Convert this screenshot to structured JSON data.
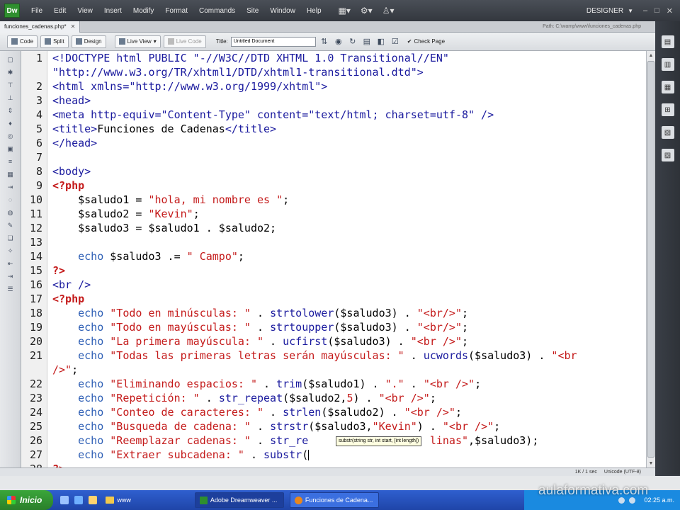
{
  "menubar": {
    "logo": "Dw",
    "items": [
      "File",
      "Edit",
      "View",
      "Insert",
      "Modify",
      "Format",
      "Commands",
      "Site",
      "Window",
      "Help"
    ],
    "workspace": "DESIGNER"
  },
  "tabs": {
    "doc_tab": "funciones_cadenas.php*",
    "path": "Path: C:\\wamp\\www\\funciones_cadenas.php"
  },
  "toolbar": {
    "code": "Code",
    "split": "Split",
    "design": "Design",
    "live_view": "Live View",
    "live_code": "Live Code",
    "title_label": "Title:",
    "title_value": "Untitled Document",
    "check_page": "Check Page"
  },
  "tooltip": "substr(string str, int start, [int length])",
  "status": {
    "size": "1K / 1 sec",
    "encoding": "Unicode (UTF-8)"
  },
  "taskbar": {
    "start": "Inicio",
    "folder": "www",
    "task1": "Adobe Dreamweaver ...",
    "task2": "Funciones de Cadena...",
    "clock": "02:25 a.m."
  },
  "watermark": "aulaformativa.com",
  "editor": {
    "lines": [
      {
        "n": "1",
        "tokens": [
          [
            "tag",
            "<!DOCTYPE html PUBLIC \"-//W3C//DTD XHTML 1.0 Transitional//EN\""
          ]
        ]
      },
      {
        "n": "",
        "tokens": [
          [
            "tag",
            "\"http://www.w3.org/TR/xhtml1/DTD/xhtml1-transitional.dtd\">"
          ]
        ]
      },
      {
        "n": "2",
        "tokens": [
          [
            "tag",
            "<html xmlns=\"http://www.w3.org/1999/xhtml\">"
          ]
        ]
      },
      {
        "n": "3",
        "tokens": [
          [
            "tag",
            "<head>"
          ]
        ]
      },
      {
        "n": "4",
        "tokens": [
          [
            "tag",
            "<meta http-equiv=\"Content-Type\" content=\"text/html; charset=utf-8\" />"
          ]
        ]
      },
      {
        "n": "5",
        "tokens": [
          [
            "tag",
            "<title>"
          ],
          [
            "pl",
            "Funciones de Cadenas"
          ],
          [
            "tag",
            "</title>"
          ]
        ]
      },
      {
        "n": "6",
        "tokens": [
          [
            "tag",
            "</head>"
          ]
        ]
      },
      {
        "n": "7",
        "tokens": []
      },
      {
        "n": "8",
        "tokens": [
          [
            "tag",
            "<body>"
          ]
        ]
      },
      {
        "n": "9",
        "tokens": [
          [
            "php",
            "<?php"
          ]
        ]
      },
      {
        "n": "10",
        "tokens": [
          [
            "var",
            "    $saludo1 = "
          ],
          [
            "str",
            "\"hola, mi nombre es \""
          ],
          [
            "pl",
            ";"
          ]
        ]
      },
      {
        "n": "11",
        "tokens": [
          [
            "var",
            "    $saludo2 = "
          ],
          [
            "str",
            "\"Kevin\""
          ],
          [
            "pl",
            ";"
          ]
        ]
      },
      {
        "n": "12",
        "tokens": [
          [
            "var",
            "    $saludo3 = $saludo1 . $saludo2;"
          ]
        ]
      },
      {
        "n": "13",
        "tokens": []
      },
      {
        "n": "14",
        "tokens": [
          [
            "kw",
            "    echo"
          ],
          [
            "var",
            " $saludo3 .= "
          ],
          [
            "str",
            "\" Campo\""
          ],
          [
            "pl",
            ";"
          ]
        ]
      },
      {
        "n": "15",
        "tokens": [
          [
            "php",
            "?>"
          ]
        ]
      },
      {
        "n": "16",
        "tokens": [
          [
            "tag",
            "<br />"
          ]
        ]
      },
      {
        "n": "17",
        "tokens": [
          [
            "php",
            "<?php"
          ]
        ]
      },
      {
        "n": "18",
        "tokens": [
          [
            "kw",
            "    echo"
          ],
          [
            "str",
            " \"Todo en minúsculas: \""
          ],
          [
            "pl",
            " . "
          ],
          [
            "fn",
            "strtolower"
          ],
          [
            "pl",
            "($saludo3) . "
          ],
          [
            "str",
            "\"<br/>\""
          ],
          [
            "pl",
            ";"
          ]
        ]
      },
      {
        "n": "19",
        "tokens": [
          [
            "kw",
            "    echo"
          ],
          [
            "str",
            " \"Todo en mayúsculas: \""
          ],
          [
            "pl",
            " . "
          ],
          [
            "fn",
            "strtoupper"
          ],
          [
            "pl",
            "($saludo3) . "
          ],
          [
            "str",
            "\"<br/>\""
          ],
          [
            "pl",
            ";"
          ]
        ]
      },
      {
        "n": "20",
        "tokens": [
          [
            "kw",
            "    echo"
          ],
          [
            "str",
            " \"La primera mayúscula: \""
          ],
          [
            "pl",
            " . "
          ],
          [
            "fn",
            "ucfirst"
          ],
          [
            "pl",
            "($saludo3) . "
          ],
          [
            "str",
            "\"<br />\""
          ],
          [
            "pl",
            ";"
          ]
        ]
      },
      {
        "n": "21",
        "tokens": [
          [
            "kw",
            "    echo"
          ],
          [
            "str",
            " \"Todas las primeras letras serán mayúsculas: \""
          ],
          [
            "pl",
            " . "
          ],
          [
            "fn",
            "ucwords"
          ],
          [
            "pl",
            "($saludo3) . "
          ],
          [
            "str",
            "\"<br"
          ]
        ]
      },
      {
        "n": "",
        "tokens": [
          [
            "str",
            "/>\""
          ],
          [
            "pl",
            ";"
          ]
        ]
      },
      {
        "n": "22",
        "tokens": [
          [
            "kw",
            "    echo"
          ],
          [
            "str",
            " \"Eliminando espacios: \""
          ],
          [
            "pl",
            " . "
          ],
          [
            "fn",
            "trim"
          ],
          [
            "pl",
            "($saludo1) . "
          ],
          [
            "str",
            "\".\""
          ],
          [
            "pl",
            " . "
          ],
          [
            "str",
            "\"<br />\""
          ],
          [
            "pl",
            ";"
          ]
        ]
      },
      {
        "n": "23",
        "tokens": [
          [
            "kw",
            "    echo"
          ],
          [
            "str",
            " \"Repetición: \""
          ],
          [
            "pl",
            " . "
          ],
          [
            "fn",
            "str_repeat"
          ],
          [
            "pl",
            "($saludo2,"
          ],
          [
            "str",
            "5"
          ],
          [
            "pl",
            ") . "
          ],
          [
            "str",
            "\"<br />\""
          ],
          [
            "pl",
            ";"
          ]
        ]
      },
      {
        "n": "24",
        "tokens": [
          [
            "kw",
            "    echo"
          ],
          [
            "str",
            " \"Conteo de caracteres: \""
          ],
          [
            "pl",
            " . "
          ],
          [
            "fn",
            "strlen"
          ],
          [
            "pl",
            "($saludo2) . "
          ],
          [
            "str",
            "\"<br />\""
          ],
          [
            "pl",
            ";"
          ]
        ]
      },
      {
        "n": "25",
        "tokens": [
          [
            "kw",
            "    echo"
          ],
          [
            "str",
            " \"Busqueda de cadena: \""
          ],
          [
            "pl",
            " . "
          ],
          [
            "fn",
            "strstr"
          ],
          [
            "pl",
            "($saludo3,"
          ],
          [
            "str",
            "\"Kevin\""
          ],
          [
            "pl",
            ") . "
          ],
          [
            "str",
            "\"<br />\""
          ],
          [
            "pl",
            ";"
          ]
        ]
      },
      {
        "n": "26",
        "tokens": [
          [
            "kw",
            "    echo"
          ],
          [
            "str",
            " \"Reemplazar cadenas: \""
          ],
          [
            "pl",
            " . "
          ],
          [
            "fn",
            "str_re"
          ],
          [
            "pl",
            "                   "
          ],
          [
            "str",
            "linas\""
          ],
          [
            "pl",
            ",$saludo3);"
          ]
        ]
      },
      {
        "n": "27",
        "tokens": [
          [
            "kw",
            "    echo"
          ],
          [
            "str",
            " \"Extraer subcadena: \""
          ],
          [
            "pl",
            " . "
          ],
          [
            "fn",
            "substr"
          ],
          [
            "pl",
            "("
          ]
        ]
      },
      {
        "n": "28",
        "tokens": [
          [
            "php",
            "?>"
          ]
        ]
      }
    ]
  }
}
